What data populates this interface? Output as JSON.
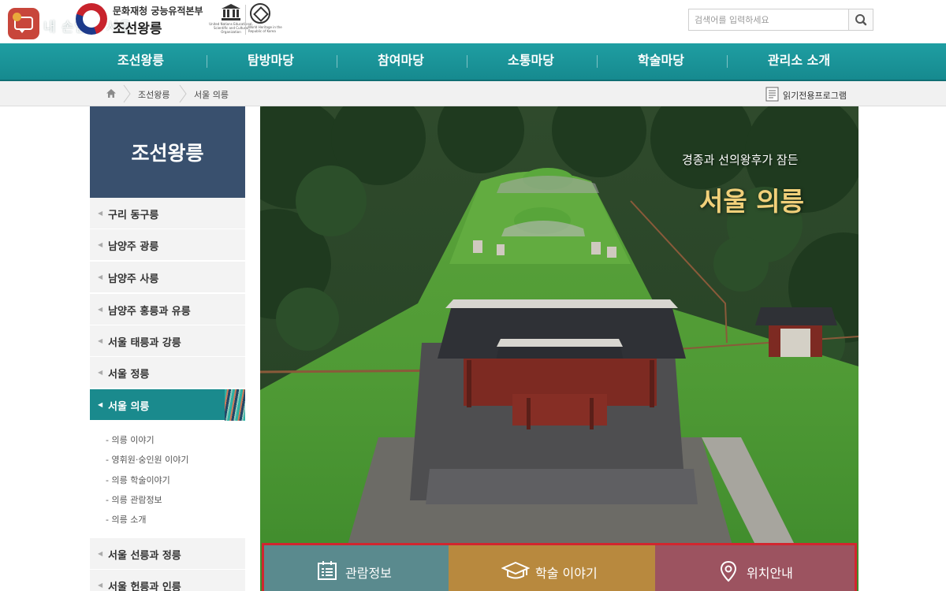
{
  "header": {
    "watermark": "내 손안에 서울",
    "org_name": "문화재청 궁능유적본부",
    "site_name": "조선왕릉",
    "unesco_caption": "United Nations Educational, Scientific and Cultural Organization",
    "whc_caption": "World Heritage in the Republic of Korea",
    "search": {
      "placeholder": "검색어를 입력하세요",
      "icon": "search-icon"
    }
  },
  "gnb": {
    "items": [
      "조선왕릉",
      "탐방마당",
      "참여마당",
      "소통마당",
      "학술마당",
      "관리소 소개"
    ]
  },
  "breadcrumb": {
    "items": [
      "조선왕릉",
      "서울 의릉"
    ],
    "reader_label": "읽기전용프로그램"
  },
  "sidebar": {
    "title": "조선왕릉",
    "items": [
      {
        "label": "구리 동구릉"
      },
      {
        "label": "남양주 광릉"
      },
      {
        "label": "남양주 사릉"
      },
      {
        "label": "남양주 홍릉과 유릉"
      },
      {
        "label": "서울 태릉과 강릉"
      },
      {
        "label": "서울 정릉"
      },
      {
        "label": "서울 의릉"
      },
      {
        "label": "서울 선릉과 정릉"
      },
      {
        "label": "서울 헌릉과 인릉"
      }
    ],
    "active_index": 6,
    "sub_items": [
      "- 의릉 이야기",
      "- 영휘원·숭인원 이야기",
      "- 의릉 학술이야기",
      "- 의릉 관람정보",
      "- 의릉 소개"
    ]
  },
  "hero": {
    "subtitle": "경종과 선의왕후가 잠든",
    "title": "서울 의릉"
  },
  "quick_links": [
    {
      "label": "관람정보",
      "icon": "calendar-list-icon",
      "color": "#5a8a8e"
    },
    {
      "label": "학술 이야기",
      "icon": "graduation-cap-icon",
      "color": "#b8893e"
    },
    {
      "label": "위치안내",
      "icon": "map-pin-icon",
      "color": "#9c5360"
    }
  ],
  "colors": {
    "gnb": "#1a9499",
    "sidebar_title": "#39506e",
    "sidebar_active": "#1a8a8d",
    "highlight_border": "#d1262f",
    "hero_title": "#f1d07a"
  }
}
